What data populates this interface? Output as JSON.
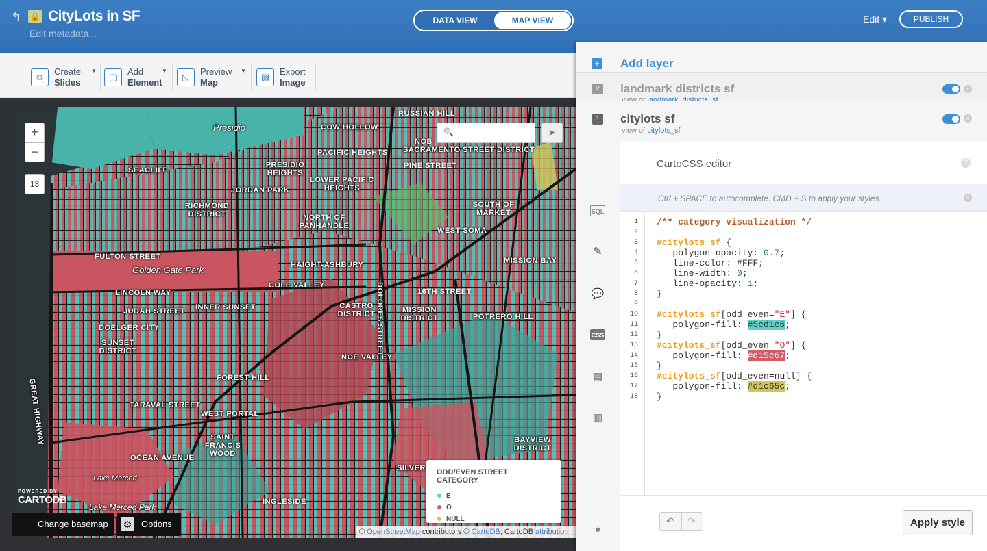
{
  "header": {
    "title": "CityLots in SF",
    "subtitle": "Edit metadata...",
    "view_data": "DATA VIEW",
    "view_map": "MAP VIEW",
    "edit": "Edit ▾",
    "publish": "PUBLISH"
  },
  "toolbar": [
    {
      "line1": "Create",
      "line2": "Slides",
      "icon": "slides-icon"
    },
    {
      "line1": "Add",
      "line2": "Element",
      "icon": "element-icon"
    },
    {
      "line1": "Preview",
      "line2": "Map",
      "icon": "preview-icon"
    },
    {
      "line1": "Export",
      "line2": "Image",
      "icon": "image-icon"
    }
  ],
  "map": {
    "zoom_in": "+",
    "zoom_out": "−",
    "zoom_level": "13",
    "labels": [
      "RUSSIAN HILL",
      "COW HOLLOW",
      "Presidio",
      "NOB",
      "PACIFIC HEIGHTS",
      "SACRAMENTO STREET DISTRICT",
      "PINE STREET",
      "SEACLIFF",
      "PRESIDIO HEIGHTS",
      "JORDAN PARK",
      "LOWER PACIFIC HEIGHTS",
      "RICHMOND DISTRICT",
      "NORTH OF PANHANDLE",
      "SOUTH OF MARKET",
      "WEST SOMA",
      "FULTON STREET",
      "HAIGHT-ASHBURY",
      "MISSION BAY",
      "Golden Gate Park",
      "COLE VALLEY",
      "LINCOLN WAY",
      "16TH STREET",
      "CASTRO DISTRICT",
      "JUDAH STREET",
      "INNER SUNSET",
      "MISSION DISTRICT",
      "POTRERO HILL",
      "DOELGER CITY",
      "SUNSET DISTRICT",
      "GREAT HIGHWAY",
      "NOE VALLEY",
      "FOREST HILL",
      "TARAVAL STREET",
      "WEST PORTAL",
      "SAINT FRANCIS WOOD",
      "OCEAN AVENUE",
      "BAYVIEW DISTRICT",
      "Lake Merced",
      "SILVER",
      "INGLESIDE",
      "Lake Merced Park",
      "DOLORES STREET"
    ],
    "legend": {
      "title": "ODD/EVEN STREET CATEGORY",
      "items": [
        {
          "label": "E",
          "color": "#5cd1c6"
        },
        {
          "label": "O",
          "color": "#d15c67"
        },
        {
          "label": "NULL",
          "color": "#d1c65c"
        }
      ]
    },
    "powered": "POWERED BY",
    "brand": "CARTODB",
    "change_basemap": "Change basemap",
    "options": "Options",
    "attribution": {
      "pre": "© ",
      "osm": "OpenStreetMap",
      "mid": " contributors © ",
      "cartodb": "CartoDB",
      "mid2": ", CartoDB ",
      "attr": "attribution"
    }
  },
  "panel": {
    "add_layer": "Add layer",
    "layers": [
      {
        "num": "2",
        "name": "landmark districts sf",
        "view_of": "view of",
        "table": "landmark_districts_sf"
      },
      {
        "num": "1",
        "name": "citylots sf",
        "view_of": "view of",
        "table": "citylots_sf"
      }
    ],
    "nav": [
      "SQL",
      "wizard-icon",
      "infowindow-icon",
      "CSS",
      "legend-icon",
      "filters-icon"
    ],
    "editor_title": "CartoCSS editor",
    "hint": "Ctrl + SPACE to autocomplete. CMD + S to apply your styles.",
    "line_numbers": [
      "1",
      "2",
      "3",
      "4",
      "5",
      "6",
      "7",
      "8",
      "9",
      "10",
      "11",
      "12",
      "13",
      "14",
      "15",
      "16",
      "17",
      "18"
    ],
    "apply": "Apply style"
  },
  "colors": {
    "accent": "#3d7fc5",
    "even": "#5cd1c6",
    "odd": "#d15c67",
    "null": "#d1c65c"
  }
}
